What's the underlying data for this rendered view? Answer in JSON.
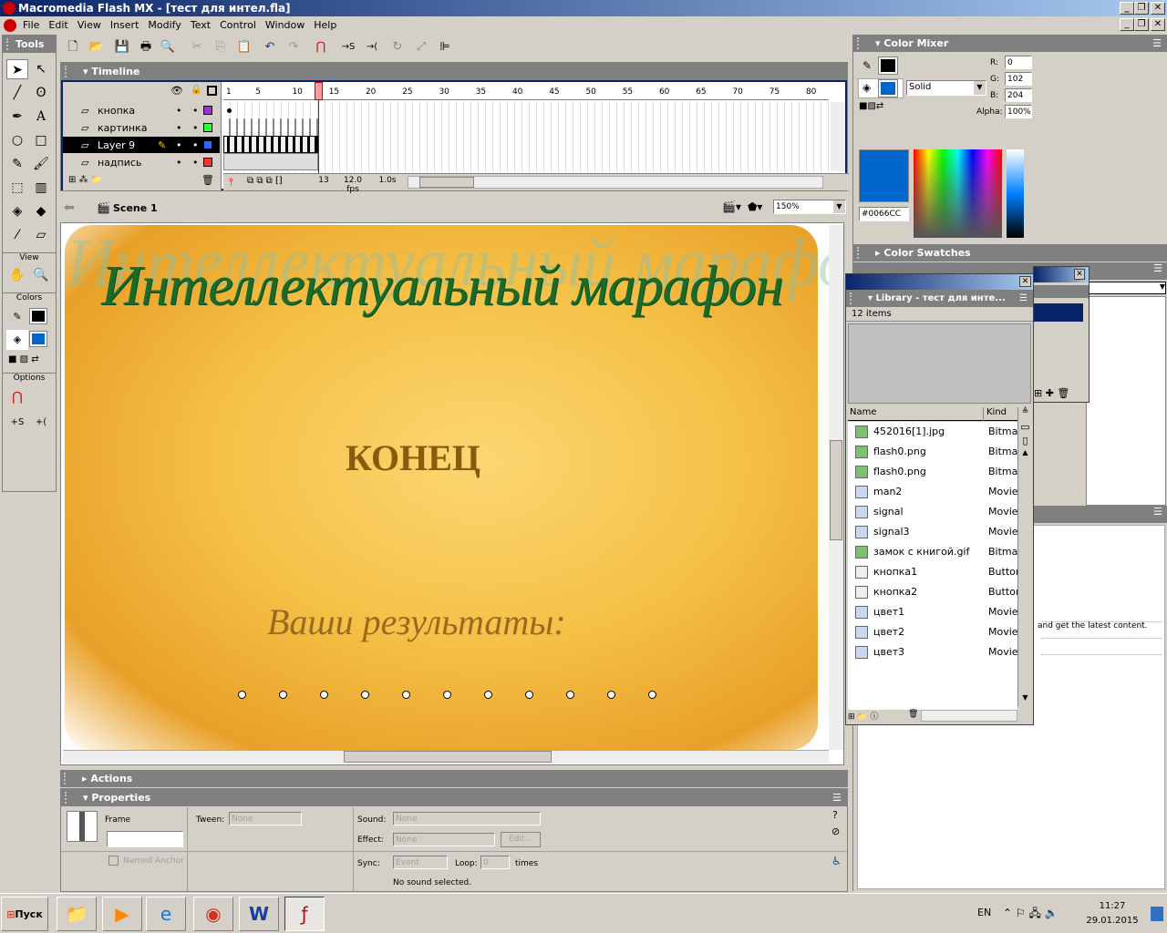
{
  "app": {
    "title": "Macromedia Flash MX - [тест для интел.fla]"
  },
  "menu": [
    "File",
    "Edit",
    "View",
    "Insert",
    "Modify",
    "Text",
    "Control",
    "Window",
    "Help"
  ],
  "tools": {
    "title": "Tools",
    "view_label": "View",
    "colors_label": "Colors",
    "options_label": "Options"
  },
  "timeline": {
    "title": "Timeline",
    "layers": [
      {
        "name": "кнопка",
        "color": "#9933cc"
      },
      {
        "name": "картинка",
        "color": "#33ff33"
      },
      {
        "name": "Layer 9",
        "color": "#3366ff",
        "selected": true
      },
      {
        "name": "надпись",
        "color": "#ff3333"
      }
    ],
    "frame_numbers": [
      "1",
      "5",
      "10",
      "15",
      "20",
      "25",
      "30",
      "35",
      "40",
      "45",
      "50",
      "55",
      "60",
      "65",
      "70",
      "75",
      "80"
    ],
    "current_frame": "13",
    "fps": "12.0 fps",
    "time": "1.0s"
  },
  "editbar": {
    "scene": "Scene 1",
    "zoom": "150%"
  },
  "stage": {
    "watermark": "Интеллектуальный марафон",
    "title": "Интеллектуальный марафон",
    "end_text": "КОНЕЦ",
    "results_text": "Ваши результаты:",
    "title_color": "#1a6b2a",
    "text_color": "#8b5a10"
  },
  "actions": {
    "title": "Actions"
  },
  "properties": {
    "title": "Properties",
    "frame_label": "Frame",
    "tween_label": "Tween:",
    "tween_value": "None",
    "sound_label": "Sound:",
    "sound_value": "None",
    "effect_label": "Effect:",
    "effect_value": "None",
    "edit_button": "Edit...",
    "sync_label": "Sync:",
    "sync_value": "Event",
    "loop_label": "Loop:",
    "loop_value": "0",
    "times_label": "times",
    "named_anchor": "Named Anchor",
    "no_sound": "No sound selected."
  },
  "color_mixer": {
    "title": "Color Mixer",
    "r_label": "R:",
    "r": "0",
    "g_label": "G:",
    "g": "102",
    "b_label": "B:",
    "b": "204",
    "alpha_label": "Alpha:",
    "alpha": "100%",
    "fill_type": "Solid",
    "hex": "#0066CC",
    "fill_color": "#0066CC",
    "stroke_color": "#000000"
  },
  "color_swatches": {
    "title": "Color Swatches"
  },
  "library": {
    "title": "Library - тест для инте...",
    "count": "12 items",
    "col_name": "Name",
    "col_kind": "Kind",
    "items": [
      {
        "name": "452016[1].jpg",
        "kind": "Bitmap",
        "icon": "bitmap-icon"
      },
      {
        "name": "flash0.png",
        "kind": "Bitmap",
        "icon": "bitmap-icon"
      },
      {
        "name": "flash0.png",
        "kind": "Bitmap",
        "icon": "bitmap-icon"
      },
      {
        "name": "man2",
        "kind": "Movie",
        "icon": "movieclip-icon"
      },
      {
        "name": "signal",
        "kind": "Movie",
        "icon": "movieclip-icon"
      },
      {
        "name": "signal3",
        "kind": "Movie",
        "icon": "movieclip-icon"
      },
      {
        "name": "замок с книгой.gif",
        "kind": "Bitmap",
        "icon": "bitmap-icon"
      },
      {
        "name": "кнопка1",
        "kind": "Button",
        "icon": "button-icon"
      },
      {
        "name": "кнопка2",
        "kind": "Button",
        "icon": "button-icon"
      },
      {
        "name": "цвет1",
        "kind": "Movie",
        "icon": "movieclip-icon"
      },
      {
        "name": "цвет2",
        "kind": "Movie",
        "icon": "movieclip-icon"
      },
      {
        "name": "цвет3",
        "kind": "Movie",
        "icon": "movieclip-icon"
      }
    ]
  },
  "answers_panel": {
    "text": "and get the latest content."
  },
  "taskbar": {
    "start": "Пуск",
    "lang": "EN",
    "time": "11:27",
    "date": "29.01.2015"
  }
}
